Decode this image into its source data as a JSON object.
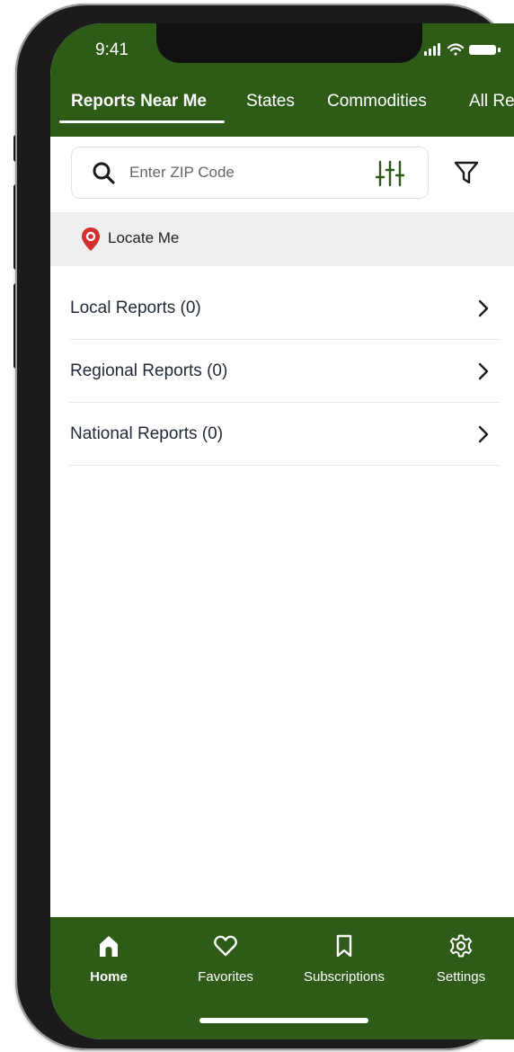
{
  "status_bar": {
    "time": "9:41"
  },
  "tabs": [
    {
      "label": "Reports Near Me",
      "active": true
    },
    {
      "label": "States",
      "active": false
    },
    {
      "label": "Commodities",
      "active": false
    },
    {
      "label": "All Rep",
      "active": false
    }
  ],
  "search": {
    "placeholder": "Enter ZIP Code",
    "value": ""
  },
  "locate": {
    "label": "Locate Me"
  },
  "reports": [
    {
      "label": "Local Reports (0)"
    },
    {
      "label": "Regional Reports (0)"
    },
    {
      "label": "National Reports (0)"
    }
  ],
  "bottom_nav": [
    {
      "label": "Home",
      "icon": "home-icon",
      "active": true
    },
    {
      "label": "Favorites",
      "icon": "heart-icon",
      "active": false
    },
    {
      "label": "Subscriptions",
      "icon": "bookmark-icon",
      "active": false
    },
    {
      "label": "Settings",
      "icon": "gear-icon",
      "active": false
    }
  ],
  "colors": {
    "brand_green": "#2e5b17",
    "pin_red": "#d32f2f",
    "locate_bg": "#efefef"
  }
}
